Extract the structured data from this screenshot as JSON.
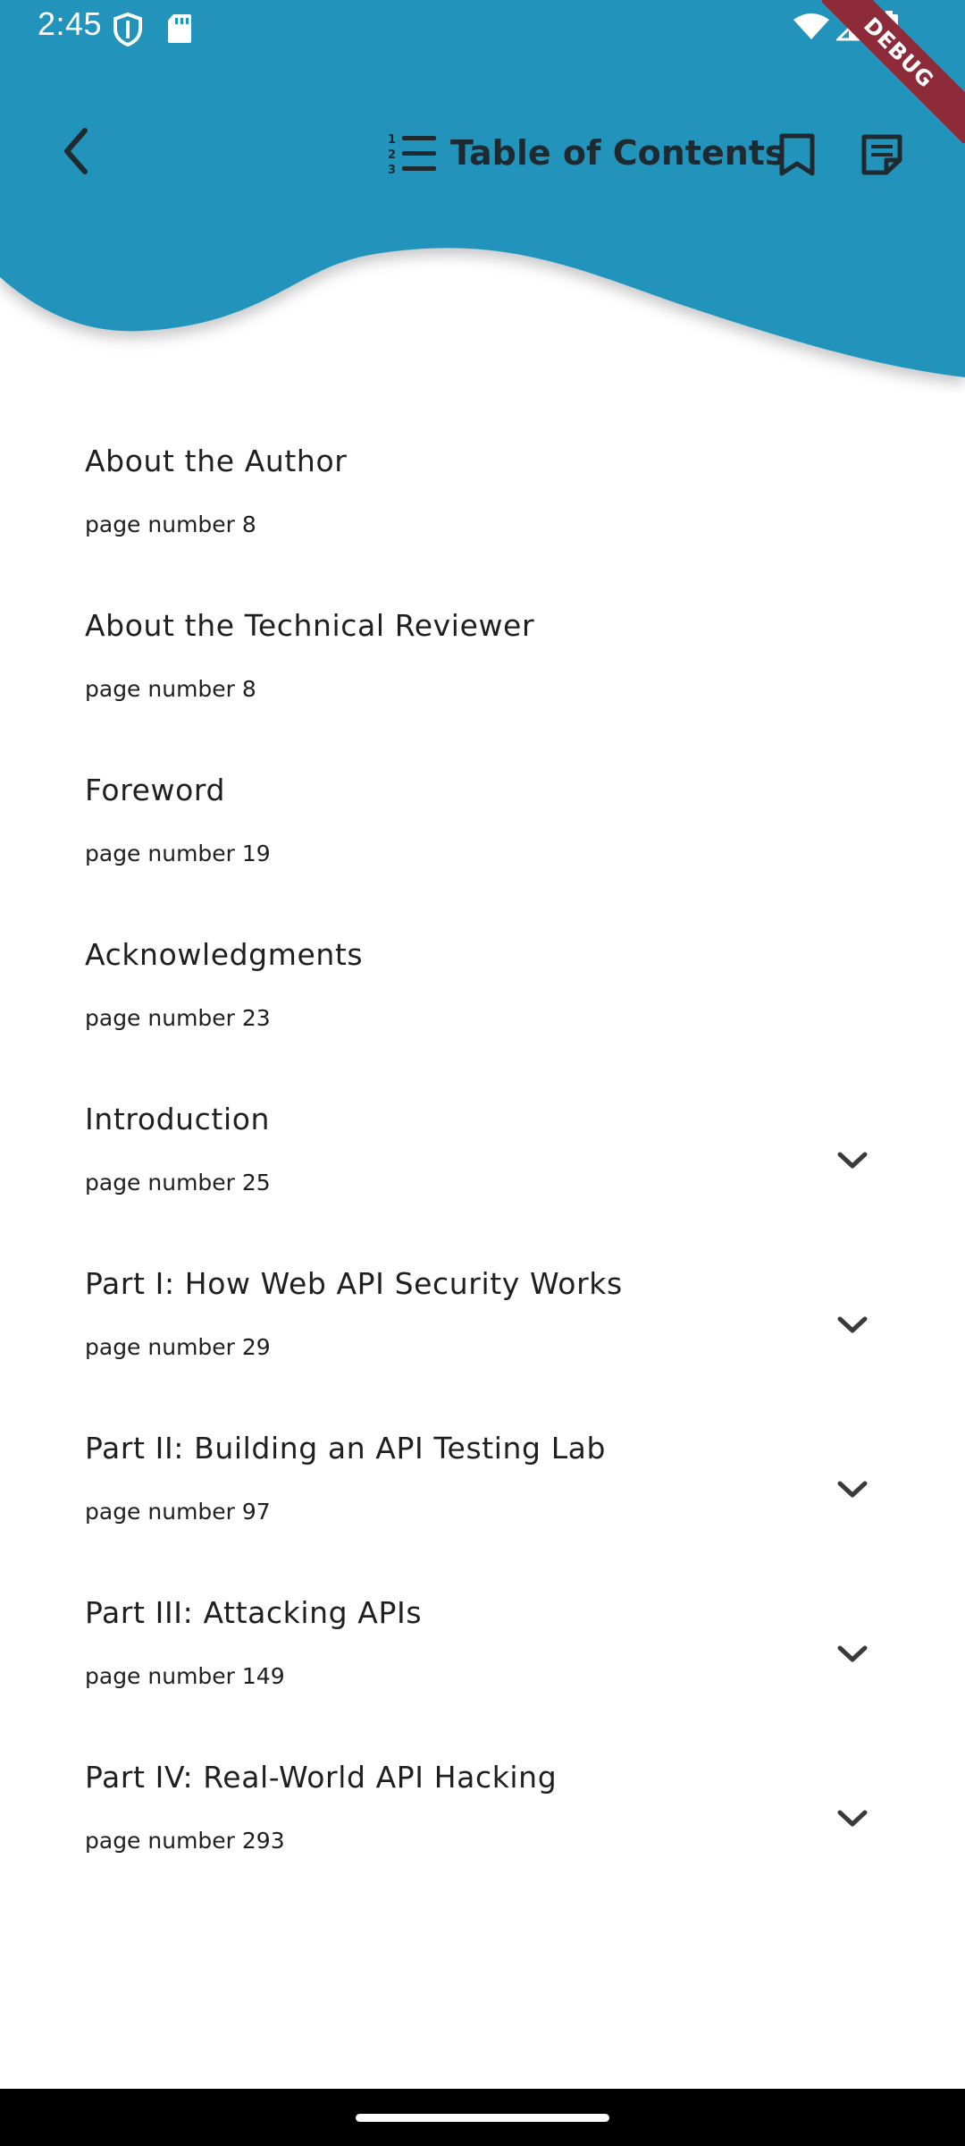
{
  "status_bar": {
    "time": "2:45",
    "icons": [
      "shield-icon",
      "sd-card-icon",
      "wifi-icon",
      "signal-icon",
      "battery-icon"
    ]
  },
  "debug_banner": {
    "label": "DEBUG"
  },
  "app_bar": {
    "title": "Table of Contents",
    "background_color": "#2194bb",
    "icons": [
      "back-icon",
      "numbered-list-icon",
      "bookmark-icon",
      "notes-icon"
    ]
  },
  "toc": {
    "items": [
      {
        "title": "About the Author",
        "page": "page number 8",
        "expandable": false
      },
      {
        "title": "About the Technical Reviewer",
        "page": "page number 8",
        "expandable": false
      },
      {
        "title": "Foreword",
        "page": "page number 19",
        "expandable": false
      },
      {
        "title": "Acknowledgments",
        "page": "page number 23",
        "expandable": false
      },
      {
        "title": "Introduction",
        "page": "page number 25",
        "expandable": true
      },
      {
        "title": "Part I: How Web API Security Works",
        "page": "page number 29",
        "expandable": true
      },
      {
        "title": "Part II: Building an API Testing Lab",
        "page": "page number 97",
        "expandable": true
      },
      {
        "title": "Part III: Attacking APIs",
        "page": "page number 149",
        "expandable": true
      },
      {
        "title": "Part IV: Real-World API Hacking",
        "page": "page number 293",
        "expandable": true
      }
    ]
  }
}
